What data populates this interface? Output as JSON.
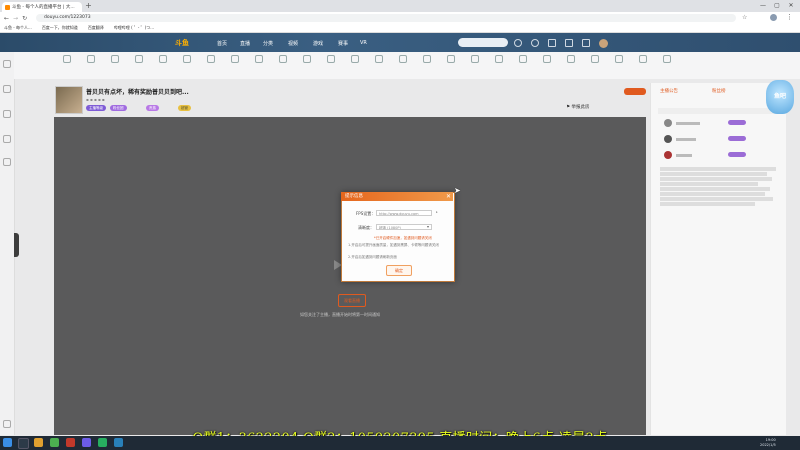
{
  "browser": {
    "tab_title": "斗鱼 - 每个人的直播平台 | 大...",
    "new_tab": "+",
    "url": "douyu.com/1223073",
    "bookmarks": [
      "斗鱼 - 每个人...",
      "百度一下，你就知道",
      "百度翻译",
      "哔哩哔哩 ( ゜- ゜)つ..."
    ],
    "window_controls": {
      "minimize": "—",
      "maximize": "▢",
      "close": "✕"
    }
  },
  "site": {
    "logo": "斗鱼",
    "nav": [
      "首页",
      "直播",
      "分类",
      "视频",
      "游戏",
      "赛事",
      "VR"
    ]
  },
  "room": {
    "title": "普贝贝有点坏，稀有奖励普贝贝到吧...",
    "report": "举报此房",
    "tags": [
      "主播等级",
      "粉丝团",
      "贵族",
      "超管"
    ]
  },
  "video": {
    "watch_button": "观看直播",
    "tip": "如您关注了主播，直播开始时将第一时间通知"
  },
  "dialog": {
    "title": "提示信息",
    "close": "✕",
    "field1_label": "FPS设置：",
    "field1_value": "http://www.douyu.com",
    "field2_label": "清晰度：",
    "field2_value": "超清 (1080P)",
    "warning": "*已开启硬件加速，如遇到问题请关闭",
    "note1": "1.开启后可提升画面质量，如遇到黑屏、卡顿等问题请关闭",
    "note2": "2.开启后如遇到问题请刷新页面",
    "ok_button": "确定"
  },
  "panel": {
    "tabs": [
      "主播公告",
      "粉丝榜"
    ],
    "mascot": "鱼吧"
  },
  "overlay": {
    "caption": "Q群1：3622204 Q群2：1059207395  直播时间：晚上6点-凌晨2点"
  },
  "taskbar": {
    "time": "19:00",
    "date": "2022/1/5"
  },
  "colors": {
    "accent": "#e05a1f",
    "caption": "#e8ff20",
    "video_bg": "#5a5a5b",
    "header": "#2b4b69"
  }
}
